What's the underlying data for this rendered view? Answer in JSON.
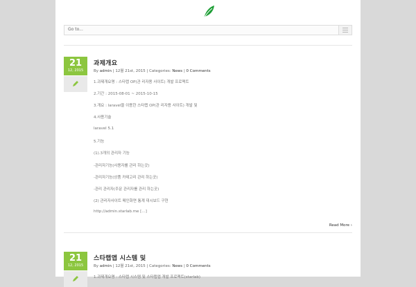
{
  "nav": {
    "select_label": "Go to..."
  },
  "posts": [
    {
      "day": "21",
      "month_year": "12, 2015",
      "title": "과제개요",
      "meta": {
        "by": "By",
        "author": "admin",
        "sep1": "|",
        "date": "12월 21st, 2015",
        "sep2": "|",
        "categories_label": "Categories:",
        "category": "News",
        "sep3": "|",
        "comments": "0 Comments"
      },
      "lines": [
        "1.과제개요명 : 스타랩 OP(관 리자용 사이트) 개발 프로젝트",
        "2.기간 : 2015-08-01 ~ 2015-10-15",
        "3.개요 : laravel을 이용한 스타랩 OP(관 리자용 사이트) 개발 및",
        "4.사용기술",
        "laravel 5.1",
        "5.기능",
        "(1).3개의 관리자 기능",
        "-관리자기능(사용자를 관리 하는곳)",
        "-관리자기능(상품 카테고리 관리 하는곳)",
        "-관리 관리자(주문 관리자를 관리 하는곳)",
        "(2) 관리자사이트 메인화면 통계 대시보드 구현",
        "http://admin.starlab.me […]"
      ],
      "read_more": "Read More"
    },
    {
      "day": "21",
      "month_year": "12, 2015",
      "title": "스타랩앱 시스템 및",
      "meta": {
        "by": "By",
        "author": "admin",
        "sep1": "|",
        "date": "12월 21st, 2015",
        "sep2": "|",
        "categories_label": "Categories:",
        "category": "News",
        "sep3": "|",
        "comments": "0 Comments"
      },
      "lines": [
        "1.과제개요명 : 스타랩 시스템 및 스타랩앱 개발 프로젝트(starlab)"
      ]
    }
  ],
  "colors": {
    "accent": "#8cc63f",
    "format_bg": "#e9e9e9",
    "page_bg": "#d9d9d9"
  }
}
